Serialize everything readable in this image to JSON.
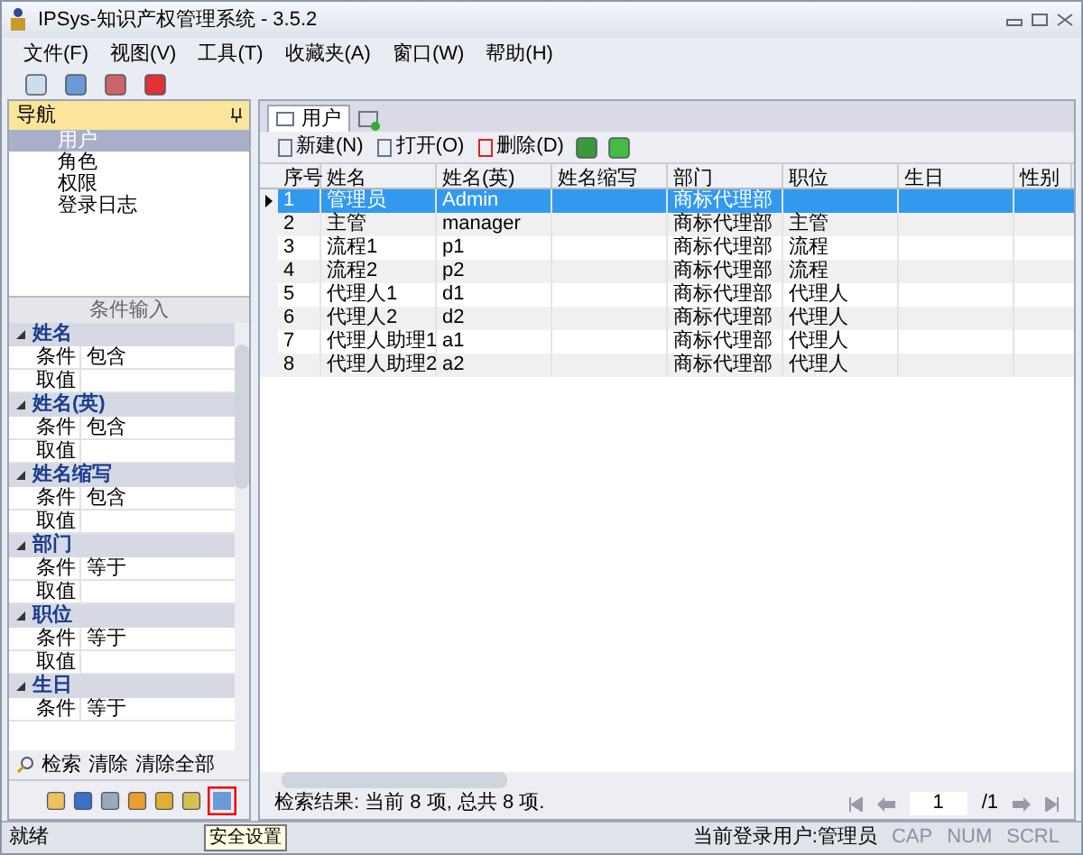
{
  "window": {
    "title": "IPSys-知识产权管理系统 - 3.5.2"
  },
  "menu": [
    "文件(F)",
    "视图(V)",
    "工具(T)",
    "收藏夹(A)",
    "窗口(W)",
    "帮助(H)"
  ],
  "nav": {
    "title": "导航",
    "items": [
      {
        "label": "用户",
        "selected": true
      },
      {
        "label": "角色",
        "selected": false
      },
      {
        "label": "权限",
        "selected": false
      },
      {
        "label": "登录日志",
        "selected": false
      }
    ]
  },
  "conditions": {
    "title": "条件输入",
    "groups": [
      {
        "label": "姓名",
        "expanded": true,
        "rows": [
          {
            "label": "条件",
            "value": "包含"
          },
          {
            "label": "取值"
          }
        ]
      },
      {
        "label": "姓名(英)",
        "expanded": true,
        "rows": [
          {
            "label": "条件",
            "value": "包含"
          },
          {
            "label": "取值"
          }
        ]
      },
      {
        "label": "姓名缩写",
        "expanded": true,
        "rows": [
          {
            "label": "条件",
            "value": "包含"
          },
          {
            "label": "取值"
          }
        ]
      },
      {
        "label": "部门",
        "expanded": true,
        "rows": [
          {
            "label": "条件",
            "value": "等于"
          },
          {
            "label": "取值"
          }
        ]
      },
      {
        "label": "职位",
        "expanded": true,
        "rows": [
          {
            "label": "条件",
            "value": "等于"
          },
          {
            "label": "取值"
          }
        ]
      },
      {
        "label": "生日",
        "expanded": true,
        "rows": [
          {
            "label": "条件",
            "value": "等于"
          }
        ]
      }
    ]
  },
  "search_actions": [
    "检索",
    "清除",
    "清除全部"
  ],
  "tooltip": "安全设置",
  "doc_tabs": [
    {
      "label": "用户",
      "selected": true
    }
  ],
  "grid_toolbar": [
    "新建(N)",
    "打开(O)",
    "删除(D)"
  ],
  "table": {
    "columns": [
      "序号",
      "姓名",
      "姓名(英)",
      "姓名缩写",
      "部门",
      "职位",
      "生日",
      "性别"
    ],
    "rows": [
      {
        "selected": true,
        "cells": [
          "1",
          "管理员",
          "Admin",
          "",
          "商标代理部",
          "",
          ""
        ]
      },
      {
        "selected": false,
        "cells": [
          "2",
          "主管",
          "manager",
          "",
          "商标代理部",
          "主管",
          ""
        ]
      },
      {
        "selected": false,
        "cells": [
          "3",
          "流程1",
          "p1",
          "",
          "商标代理部",
          "流程",
          ""
        ]
      },
      {
        "selected": false,
        "cells": [
          "4",
          "流程2",
          "p2",
          "",
          "商标代理部",
          "流程",
          ""
        ]
      },
      {
        "selected": false,
        "cells": [
          "5",
          "代理人1",
          "d1",
          "",
          "商标代理部",
          "代理人",
          ""
        ]
      },
      {
        "selected": false,
        "cells": [
          "6",
          "代理人2",
          "d2",
          "",
          "商标代理部",
          "代理人",
          ""
        ]
      },
      {
        "selected": false,
        "cells": [
          "7",
          "代理人助理1",
          "a1",
          "",
          "商标代理部",
          "代理人",
          ""
        ]
      },
      {
        "selected": false,
        "cells": [
          "8",
          "代理人助理2",
          "a2",
          "",
          "商标代理部",
          "代理人",
          ""
        ]
      }
    ]
  },
  "result": "检索结果: 当前 8 项, 总共 8 项.",
  "pager": {
    "page": "1",
    "total": "/1"
  },
  "status": {
    "ready": "就绪",
    "user": "当前登录用户:管理员",
    "indicators": [
      {
        "label": "CAP",
        "on": false
      },
      {
        "label": "NUM",
        "on": false
      },
      {
        "label": "SCRL",
        "on": false
      }
    ]
  }
}
